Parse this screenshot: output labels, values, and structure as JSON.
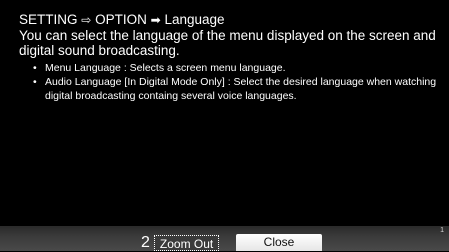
{
  "help": {
    "breadcrumb": {
      "part1": "SETTING",
      "arrow1": "⇨",
      "part2": "OPTION",
      "arrow2": "➡",
      "part3": "Language"
    },
    "intro": "You can select the language of the menu displayed on the screen and digital sound broadcasting.",
    "bullets": [
      {
        "symbol": "•",
        "text": "Menu Language : Selects a screen menu language."
      },
      {
        "symbol": "•",
        "text": "Audio Language [In Digital Mode Only] : Select the desired language when watching digital broadcasting containg several voice languages."
      }
    ],
    "page_number": "1"
  },
  "footer": {
    "zoom_number": "2",
    "zoom_label": "Zoom Out",
    "close_label": "Close"
  }
}
